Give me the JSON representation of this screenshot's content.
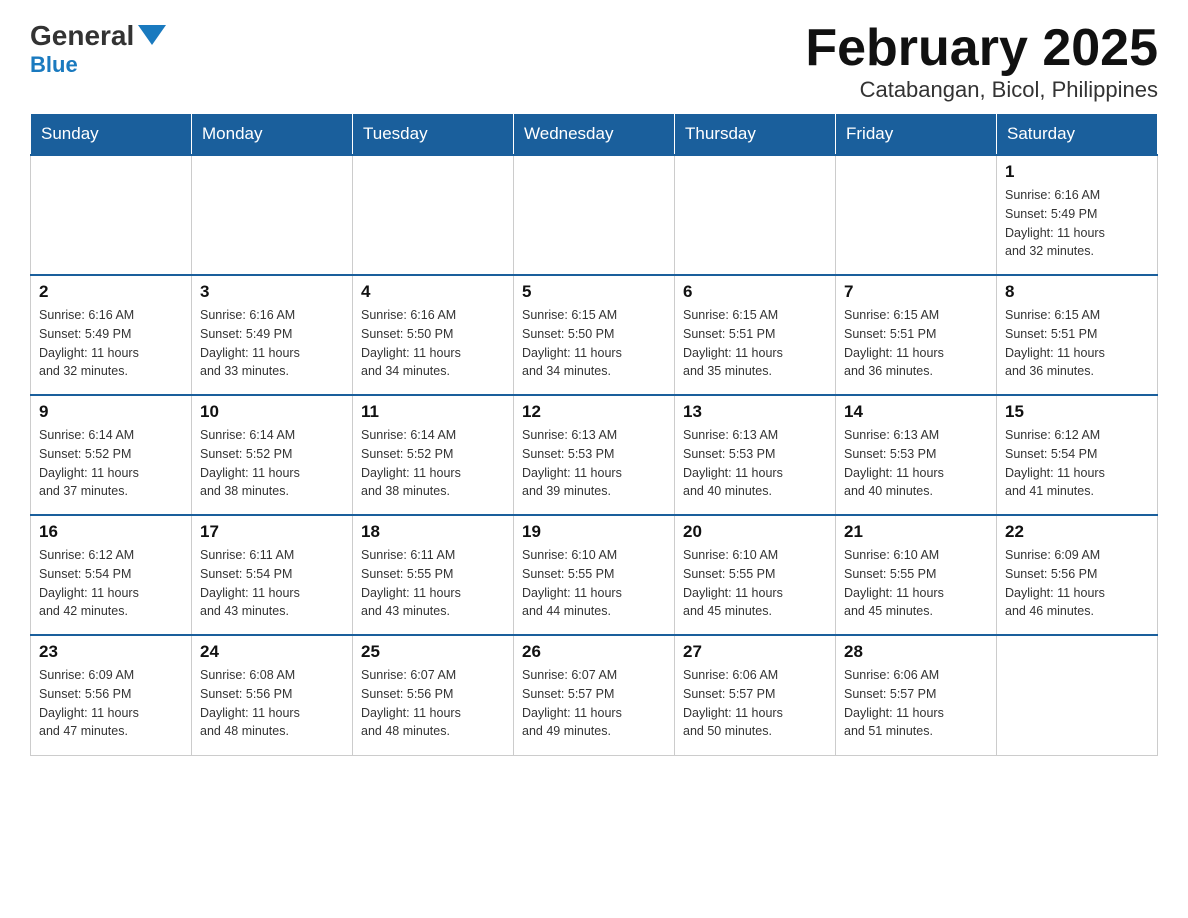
{
  "header": {
    "logo_general": "General",
    "logo_blue": "Blue",
    "title": "February 2025",
    "subtitle": "Catabangan, Bicol, Philippines"
  },
  "days_of_week": [
    "Sunday",
    "Monday",
    "Tuesday",
    "Wednesday",
    "Thursday",
    "Friday",
    "Saturday"
  ],
  "weeks": [
    {
      "days": [
        {
          "number": "",
          "info": ""
        },
        {
          "number": "",
          "info": ""
        },
        {
          "number": "",
          "info": ""
        },
        {
          "number": "",
          "info": ""
        },
        {
          "number": "",
          "info": ""
        },
        {
          "number": "",
          "info": ""
        },
        {
          "number": "1",
          "info": "Sunrise: 6:16 AM\nSunset: 5:49 PM\nDaylight: 11 hours\nand 32 minutes."
        }
      ]
    },
    {
      "days": [
        {
          "number": "2",
          "info": "Sunrise: 6:16 AM\nSunset: 5:49 PM\nDaylight: 11 hours\nand 32 minutes."
        },
        {
          "number": "3",
          "info": "Sunrise: 6:16 AM\nSunset: 5:49 PM\nDaylight: 11 hours\nand 33 minutes."
        },
        {
          "number": "4",
          "info": "Sunrise: 6:16 AM\nSunset: 5:50 PM\nDaylight: 11 hours\nand 34 minutes."
        },
        {
          "number": "5",
          "info": "Sunrise: 6:15 AM\nSunset: 5:50 PM\nDaylight: 11 hours\nand 34 minutes."
        },
        {
          "number": "6",
          "info": "Sunrise: 6:15 AM\nSunset: 5:51 PM\nDaylight: 11 hours\nand 35 minutes."
        },
        {
          "number": "7",
          "info": "Sunrise: 6:15 AM\nSunset: 5:51 PM\nDaylight: 11 hours\nand 36 minutes."
        },
        {
          "number": "8",
          "info": "Sunrise: 6:15 AM\nSunset: 5:51 PM\nDaylight: 11 hours\nand 36 minutes."
        }
      ]
    },
    {
      "days": [
        {
          "number": "9",
          "info": "Sunrise: 6:14 AM\nSunset: 5:52 PM\nDaylight: 11 hours\nand 37 minutes."
        },
        {
          "number": "10",
          "info": "Sunrise: 6:14 AM\nSunset: 5:52 PM\nDaylight: 11 hours\nand 38 minutes."
        },
        {
          "number": "11",
          "info": "Sunrise: 6:14 AM\nSunset: 5:52 PM\nDaylight: 11 hours\nand 38 minutes."
        },
        {
          "number": "12",
          "info": "Sunrise: 6:13 AM\nSunset: 5:53 PM\nDaylight: 11 hours\nand 39 minutes."
        },
        {
          "number": "13",
          "info": "Sunrise: 6:13 AM\nSunset: 5:53 PM\nDaylight: 11 hours\nand 40 minutes."
        },
        {
          "number": "14",
          "info": "Sunrise: 6:13 AM\nSunset: 5:53 PM\nDaylight: 11 hours\nand 40 minutes."
        },
        {
          "number": "15",
          "info": "Sunrise: 6:12 AM\nSunset: 5:54 PM\nDaylight: 11 hours\nand 41 minutes."
        }
      ]
    },
    {
      "days": [
        {
          "number": "16",
          "info": "Sunrise: 6:12 AM\nSunset: 5:54 PM\nDaylight: 11 hours\nand 42 minutes."
        },
        {
          "number": "17",
          "info": "Sunrise: 6:11 AM\nSunset: 5:54 PM\nDaylight: 11 hours\nand 43 minutes."
        },
        {
          "number": "18",
          "info": "Sunrise: 6:11 AM\nSunset: 5:55 PM\nDaylight: 11 hours\nand 43 minutes."
        },
        {
          "number": "19",
          "info": "Sunrise: 6:10 AM\nSunset: 5:55 PM\nDaylight: 11 hours\nand 44 minutes."
        },
        {
          "number": "20",
          "info": "Sunrise: 6:10 AM\nSunset: 5:55 PM\nDaylight: 11 hours\nand 45 minutes."
        },
        {
          "number": "21",
          "info": "Sunrise: 6:10 AM\nSunset: 5:55 PM\nDaylight: 11 hours\nand 45 minutes."
        },
        {
          "number": "22",
          "info": "Sunrise: 6:09 AM\nSunset: 5:56 PM\nDaylight: 11 hours\nand 46 minutes."
        }
      ]
    },
    {
      "days": [
        {
          "number": "23",
          "info": "Sunrise: 6:09 AM\nSunset: 5:56 PM\nDaylight: 11 hours\nand 47 minutes."
        },
        {
          "number": "24",
          "info": "Sunrise: 6:08 AM\nSunset: 5:56 PM\nDaylight: 11 hours\nand 48 minutes."
        },
        {
          "number": "25",
          "info": "Sunrise: 6:07 AM\nSunset: 5:56 PM\nDaylight: 11 hours\nand 48 minutes."
        },
        {
          "number": "26",
          "info": "Sunrise: 6:07 AM\nSunset: 5:57 PM\nDaylight: 11 hours\nand 49 minutes."
        },
        {
          "number": "27",
          "info": "Sunrise: 6:06 AM\nSunset: 5:57 PM\nDaylight: 11 hours\nand 50 minutes."
        },
        {
          "number": "28",
          "info": "Sunrise: 6:06 AM\nSunset: 5:57 PM\nDaylight: 11 hours\nand 51 minutes."
        },
        {
          "number": "",
          "info": ""
        }
      ]
    }
  ]
}
